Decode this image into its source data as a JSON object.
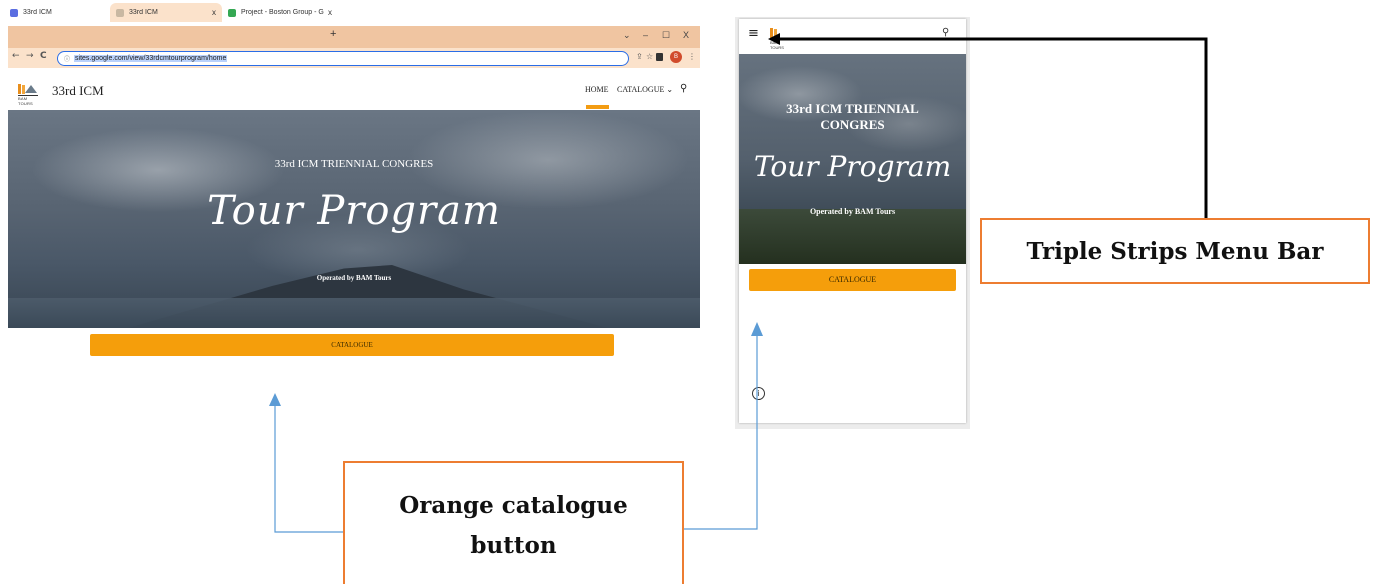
{
  "desktop": {
    "tabs": [
      {
        "label": "33rd ICM",
        "favicon_color": "#5b6ee1"
      },
      {
        "label": "33rd ICM",
        "favicon_color": "#c9b8a2"
      },
      {
        "label": "Project - Boston Group - Google",
        "favicon_color": "#34a853"
      }
    ],
    "new_tab": "+",
    "window_controls": {
      "minimize": "–",
      "maximize": "☐",
      "close": "X",
      "dropdown": "⌄"
    },
    "url": "sites.google.com/view/33rdcmtourprogram/home",
    "profile_initial": "B",
    "site": {
      "name": "33rd ICM",
      "logo_text": "BAM TOURS",
      "nav_home": "HOME",
      "nav_catalogue": "CATALOGUE ⌄",
      "hero_title": "33rd ICM TRIENNIAL CONGRES",
      "hero_script": "Tour Program",
      "hero_operated": "Operated by BAM Tours",
      "catalogue_button": "CATALOGUE"
    }
  },
  "mobile": {
    "logo_text": "BAM TOURS",
    "hero_title": "33rd ICM TRIENNIAL CONGRES",
    "hero_script": "Tour Program",
    "hero_operated": "Operated by BAM Tours",
    "catalogue_button": "CATALOGUE",
    "info_icon": "i"
  },
  "callouts": {
    "menu_bar": "Triple Strips Menu Bar",
    "catalogue_line1": "Orange catalogue",
    "catalogue_line2": "button"
  },
  "colors": {
    "accent_orange": "#f59e0b",
    "callout_border": "#ed7d31",
    "arrow_blue": "#5b9bd5",
    "tab_strip": "#f0c5a1"
  }
}
